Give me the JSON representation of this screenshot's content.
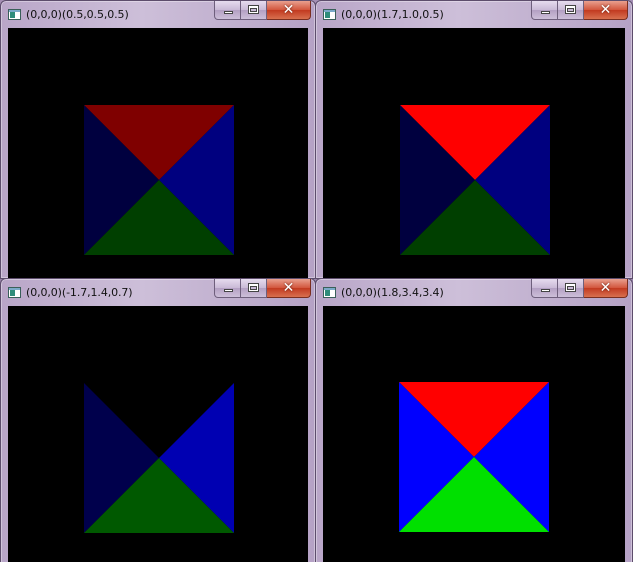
{
  "windows": [
    {
      "title": "(0,0,0)(0.5,0.5,0.5)",
      "faces": {
        "top": "#7f0000",
        "left": "#00003f",
        "right": "#00007f",
        "bottom": "#003f00"
      }
    },
    {
      "title": "(0,0,0)(1.7,1.0,0.5)",
      "faces": {
        "top": "#ff0000",
        "left": "#00003f",
        "right": "#00007f",
        "bottom": "#003f00"
      }
    },
    {
      "title": "(0,0,0)(-1.7,1.4,0.7)",
      "faces": {
        "top": "#000000",
        "left": "#00004c",
        "right": "#0000b2",
        "bottom": "#005900"
      }
    },
    {
      "title": "(0,0,0)(1.8,3.4,3.4)",
      "faces": {
        "top": "#ff0000",
        "left": "#0000ff",
        "right": "#0000ff",
        "bottom": "#00e000"
      }
    }
  ],
  "caption_icons": {
    "minimize": "minimize-icon",
    "maximize": "maximize-icon",
    "close": "close-icon"
  },
  "app_icon": "app-window-icon"
}
